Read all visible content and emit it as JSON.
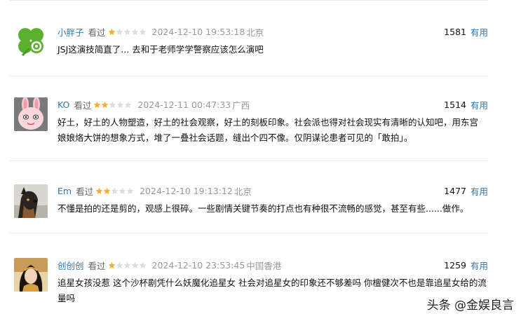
{
  "comments": [
    {
      "username": "小胖子",
      "status": "看过",
      "rating": 1,
      "rating_max": 5,
      "time": "2024-12-10 19:53:18",
      "location": "北京",
      "votes": "1581",
      "vote_label": "有用",
      "content": "JSJ这演技简直了... 去和于老师学学警察应该怎么演吧",
      "avatar": "clover-icon"
    },
    {
      "username": "KO",
      "status": "看过",
      "rating": 2,
      "rating_max": 5,
      "time": "2024-12-11 00:47:33",
      "location": "广西",
      "votes": "1514",
      "vote_label": "有用",
      "content": "好土，好土的人物塑造，好土的社会观察，好土的刻板印象。社会派也得对社会现实有清晰的认知吧，用东宫娘娘烙大饼的想象方式，堆了一叠社会话题，缝出个四不像。仅阴谋论患者可见的「敢拍」。",
      "avatar": "bunny-icon"
    },
    {
      "username": "Em",
      "status": "看过",
      "rating": 2,
      "rating_max": 5,
      "time": "2024-12-10 19:13:12",
      "location": "北京",
      "votes": "1477",
      "vote_label": "有用",
      "content": "不懂是拍的还是剪的，观感上很碎。一些剧情关键节奏的打点也有种很不流畅的感觉，甚至有些......做作。",
      "avatar": "dog-photo"
    },
    {
      "username": "创创创",
      "status": "看过",
      "rating": 1,
      "rating_max": 5,
      "time": "2024-12-10 23:53:45",
      "location": "中国香港",
      "votes": "1259",
      "vote_label": "有用",
      "content": "追星女孩没惹 这个沙杯剧凭什么妖魔化追星女 社会对追星女的印象还不够差吗 你檀健次不也是靠追星女给的流量吗",
      "avatar": "portrait-photo"
    }
  ],
  "watermark": {
    "text": "头条 @金娱良言"
  },
  "colors": {
    "link": "#3377aa",
    "star_on": "#ffac2d",
    "star_off": "#dddddd",
    "meta": "#999999"
  }
}
